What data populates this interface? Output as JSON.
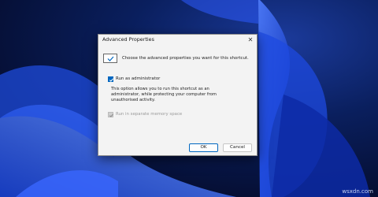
{
  "dialog": {
    "title": "Advanced Properties",
    "close_glyph": "✕",
    "intro": "Choose the advanced properties you want for this shortcut.",
    "options": [
      {
        "label": "Run as administrator",
        "checked": true,
        "enabled": true,
        "description": "This option allows you to run this shortcut as an administrator, while protecting your computer from unauthorised activity."
      },
      {
        "label": "Run in separate memory space",
        "checked": true,
        "enabled": false
      }
    ],
    "ok_label": "OK",
    "cancel_label": "Cancel"
  },
  "watermark": "wsxdn.com",
  "colors": {
    "accent": "#0067c0",
    "wallpaper": "#06123a",
    "dialog_bg": "#f3f3f3"
  }
}
